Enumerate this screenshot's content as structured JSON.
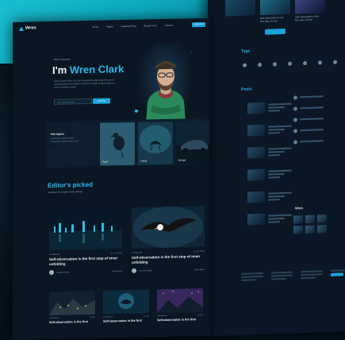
{
  "nav": {
    "logo": "Wren",
    "links": [
      "Home",
      "Pages",
      "Featured Post",
      "Recent Post",
      "Contact"
    ],
    "subscribe": "Subscribe"
  },
  "hero": {
    "greeting": "Hello Everyone",
    "title_prefix": "I'm",
    "name": "Wren Clark",
    "description": "Lorem ipsum dolor sit amet consectetur adipiscing elit sed do eiusmod tempor incididunt ut labore et dolore magna aliqua ut enim ad minim veniam",
    "email_placeholder": "Your email address",
    "subscribe_button": "Subscribe"
  },
  "hot_topics": {
    "title": "Hot topics",
    "description": "Lorem ipsum dolor sit amet consectetur adipiscing elit sed do",
    "cards": [
      {
        "label": "Sport"
      },
      {
        "label": "Travel"
      },
      {
        "label": "Design"
      }
    ]
  },
  "editors_picked": {
    "title": "Editor's picked",
    "subtitle": "Featured and highly rated articles",
    "cards": [
      {
        "category": "Architecture",
        "date": "12 Jan 2023",
        "title": "Self-observation is the first step of inner unfolding",
        "author": "Jennifer Smith",
        "more": "Read More"
      },
      {
        "category": "Architecture",
        "date": "12 Jan 2023",
        "title": "Self-observation is the first step of inner unfolding",
        "author": "Jennifer Smith",
        "more": "Read More"
      }
    ],
    "small_cards": [
      {
        "category": "Architecture",
        "date": "12 Jan",
        "title": "Self-observation is the first"
      },
      {
        "category": "Architecture",
        "date": "12 Jan",
        "title": "Self-observation is the first"
      },
      {
        "category": "Architecture",
        "date": "12 Jan",
        "title": "Self-observation is the first"
      }
    ]
  },
  "secondary_page": {
    "captions": [
      "Self-observation is the first step of inner",
      "Self-observation is the first step of inner"
    ],
    "section_tags": "Tags",
    "section_posts": "Posts",
    "widget_title": "Wren"
  },
  "colors": {
    "accent": "#2ab6ea",
    "background": "#0a1622",
    "panel": "#0d1d2b"
  }
}
